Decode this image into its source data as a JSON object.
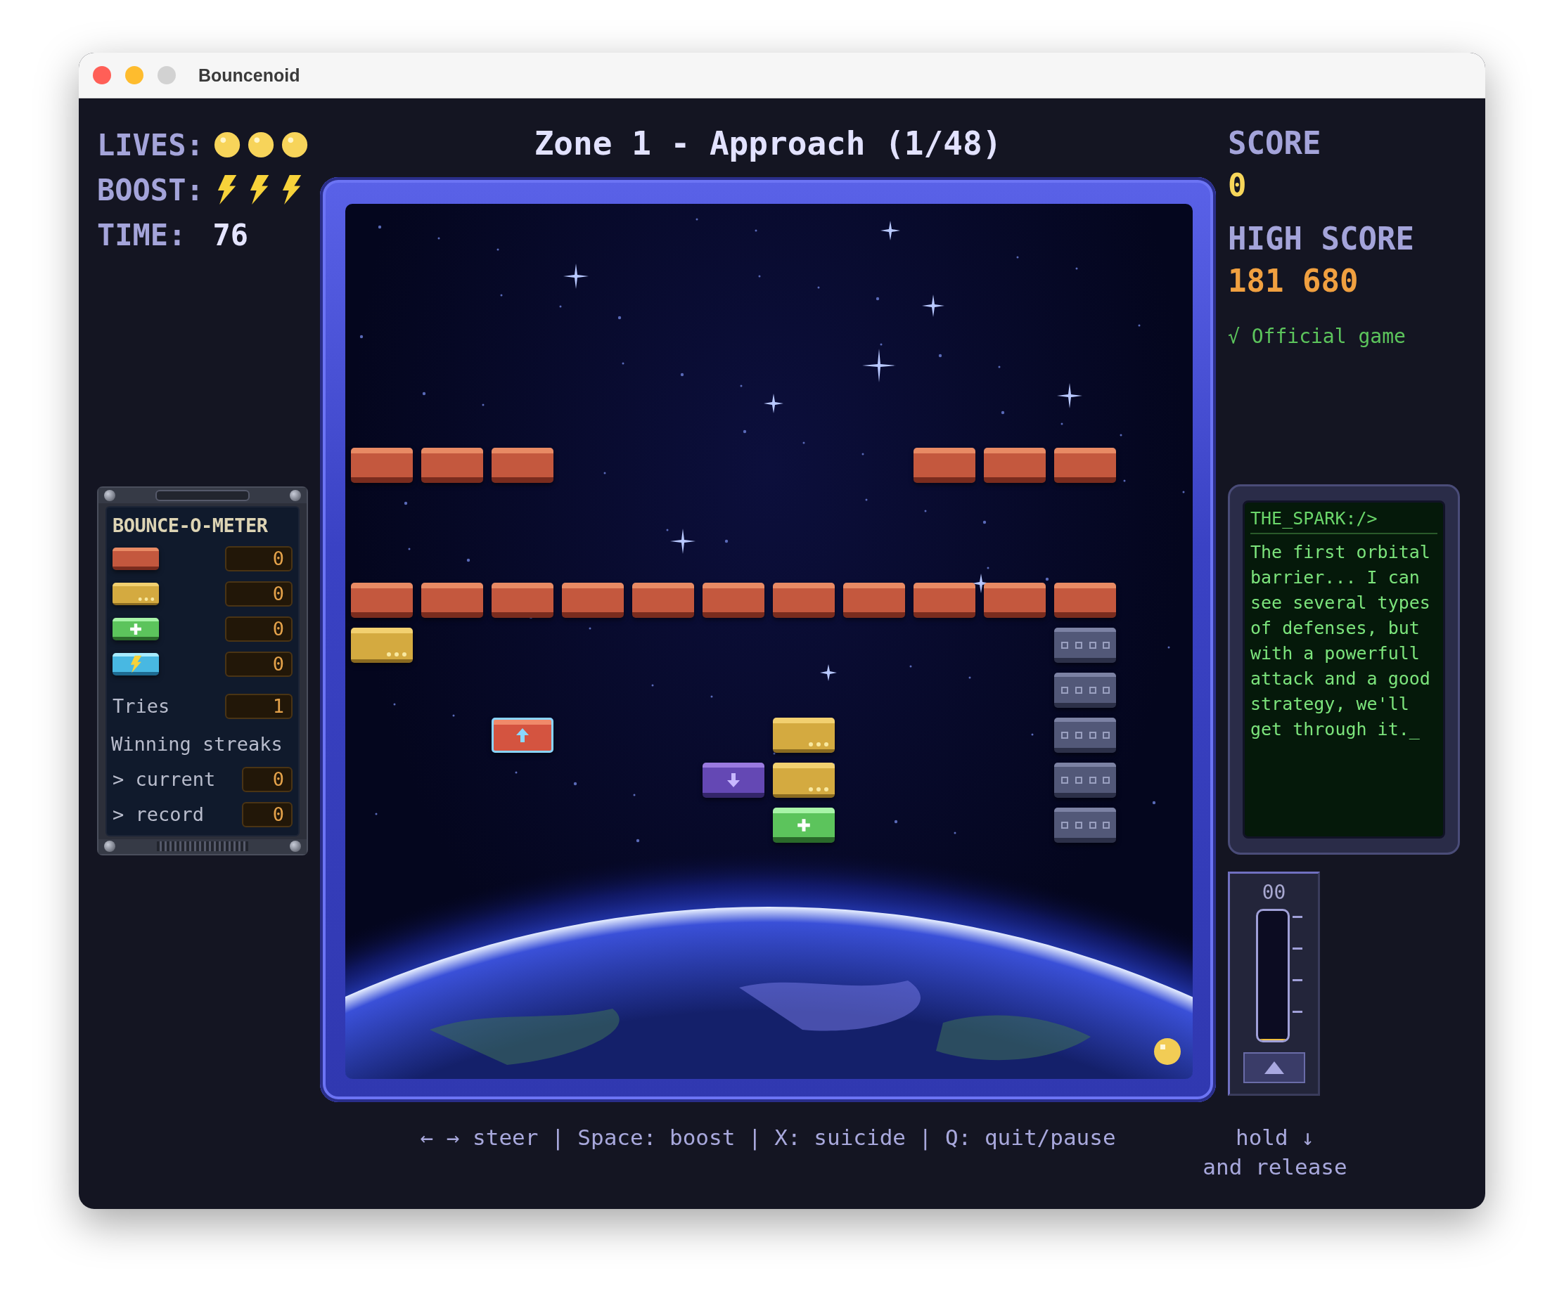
{
  "window": {
    "title": "Bouncenoid"
  },
  "hud": {
    "lives": {
      "label": "LIVES:",
      "icons": [
        {
          "kind": "ball"
        },
        {
          "kind": "ball"
        },
        {
          "kind": "ball"
        }
      ]
    },
    "boost": {
      "label": "BOOST:",
      "icons": [
        {
          "kind": "bolt"
        },
        {
          "kind": "bolt"
        },
        {
          "kind": "bolt"
        }
      ]
    },
    "time": {
      "label": "TIME:",
      "value": "76"
    }
  },
  "zone_title": "Zone 1 - Approach (1/48)",
  "score": {
    "label": "SCORE",
    "value": "0"
  },
  "high_score": {
    "label": "HIGH SCORE",
    "value": "181 680"
  },
  "official": "√ Official game",
  "bounce_o_meter": {
    "title": "BOUNCE-O-METER",
    "rows": [
      {
        "kind": "brick",
        "icon": {
          "kind": "red"
        },
        "value": "0"
      },
      {
        "kind": "brick",
        "icon": {
          "kind": "yellow"
        },
        "value": "0"
      },
      {
        "kind": "brick",
        "icon": {
          "kind": "green"
        },
        "value": "0"
      },
      {
        "kind": "brick",
        "icon": {
          "kind": "cyan"
        },
        "value": "0"
      },
      {
        "kind": "stat",
        "label": "Tries",
        "value": "1"
      },
      {
        "kind": "heading",
        "label": "Winning streaks"
      },
      {
        "kind": "sub",
        "marker": ">",
        "label": "current",
        "value": "0"
      },
      {
        "kind": "sub",
        "marker": ">",
        "label": "record",
        "value": "0"
      }
    ]
  },
  "field": {
    "rows": [
      [
        {
          "kind": "red"
        },
        {
          "kind": "red"
        },
        {
          "kind": "red"
        },
        null,
        null,
        null,
        null,
        null,
        {
          "kind": "red"
        },
        {
          "kind": "red"
        },
        {
          "kind": "red"
        }
      ],
      [
        null,
        null,
        null,
        null,
        null,
        null,
        null,
        null,
        null,
        null,
        null
      ],
      [
        null,
        null,
        null,
        null,
        null,
        null,
        null,
        null,
        null,
        null,
        null
      ],
      [
        {
          "kind": "red"
        },
        {
          "kind": "red"
        },
        {
          "kind": "red"
        },
        {
          "kind": "red"
        },
        {
          "kind": "red"
        },
        {
          "kind": "red"
        },
        {
          "kind": "red"
        },
        {
          "kind": "red"
        },
        {
          "kind": "red"
        },
        {
          "kind": "red"
        },
        {
          "kind": "red"
        }
      ],
      [
        {
          "kind": "yellow"
        },
        null,
        null,
        null,
        null,
        null,
        null,
        null,
        null,
        null,
        {
          "kind": "grey"
        }
      ],
      [
        null,
        null,
        null,
        null,
        null,
        null,
        null,
        null,
        null,
        null,
        {
          "kind": "grey"
        }
      ],
      [
        null,
        null,
        {
          "kind": "red-up"
        },
        null,
        null,
        null,
        {
          "kind": "yellow"
        },
        null,
        null,
        null,
        {
          "kind": "grey"
        }
      ],
      [
        null,
        null,
        null,
        null,
        null,
        {
          "kind": "purple-down"
        },
        {
          "kind": "yellow"
        },
        null,
        null,
        null,
        {
          "kind": "grey"
        }
      ],
      [
        null,
        null,
        null,
        null,
        null,
        null,
        {
          "kind": "green"
        },
        null,
        null,
        null,
        {
          "kind": "grey"
        }
      ]
    ]
  },
  "dialog": {
    "speaker": "THE_SPARK:/>",
    "text": "The first orbital barrier... I can see several types of defenses, but with a powerfull attack and a good strategy, we'll get through it._"
  },
  "boost_meter": {
    "reading": "00",
    "level": 0
  },
  "controls": "← → steer | Space: boost | X: suicide | Q: quit/pause",
  "boost_hint": [
    "hold ↓",
    "and release"
  ]
}
